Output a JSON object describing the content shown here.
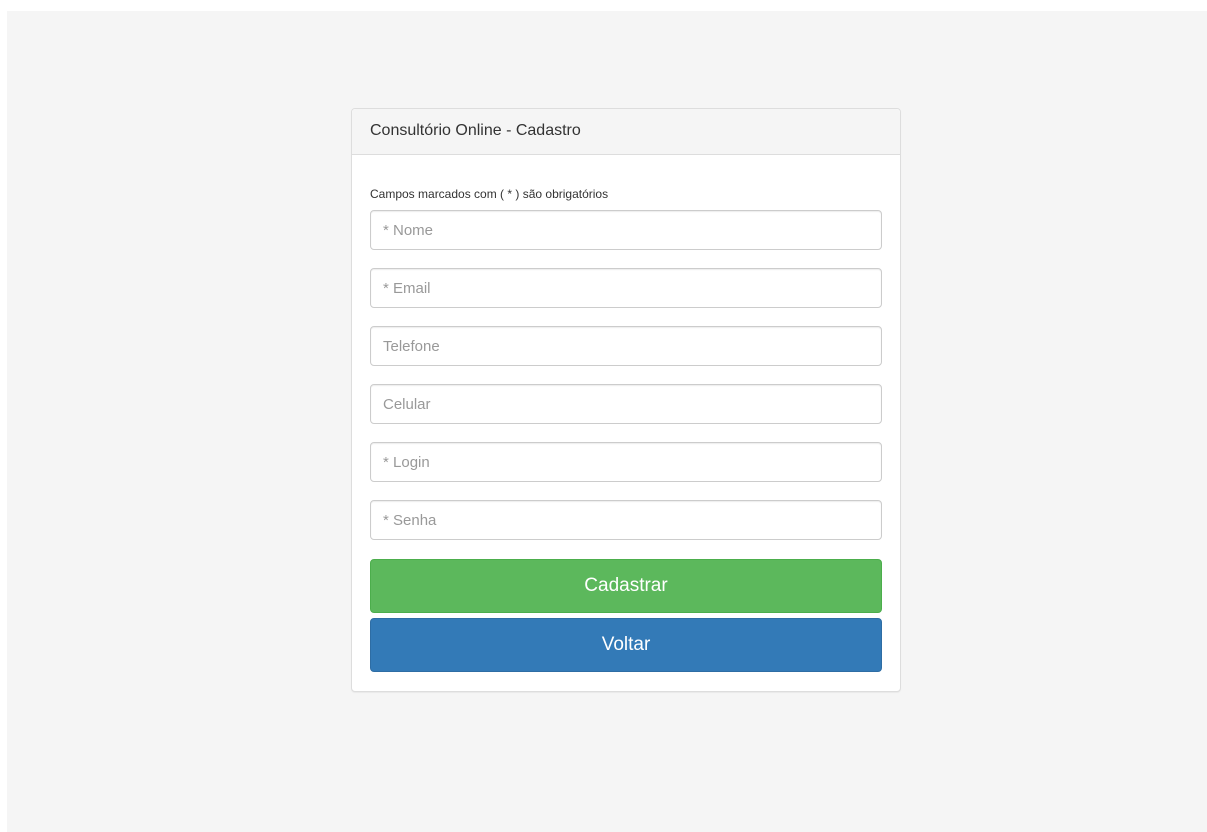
{
  "panel": {
    "title": "Consultório Online - Cadastro",
    "required_note": "Campos marcados com ( * ) são obrigatórios"
  },
  "form": {
    "fields": [
      {
        "placeholder": "* Nome",
        "value": ""
      },
      {
        "placeholder": "* Email",
        "value": ""
      },
      {
        "placeholder": "Telefone",
        "value": ""
      },
      {
        "placeholder": "Celular",
        "value": ""
      },
      {
        "placeholder": "* Login",
        "value": ""
      },
      {
        "placeholder": "* Senha",
        "value": ""
      }
    ],
    "submit_label": "Cadastrar",
    "back_label": "Voltar"
  },
  "colors": {
    "page_background": "#f5f5f5",
    "panel_heading": "#f5f5f5",
    "success_button": "#5cb85c",
    "primary_button": "#337ab7"
  }
}
